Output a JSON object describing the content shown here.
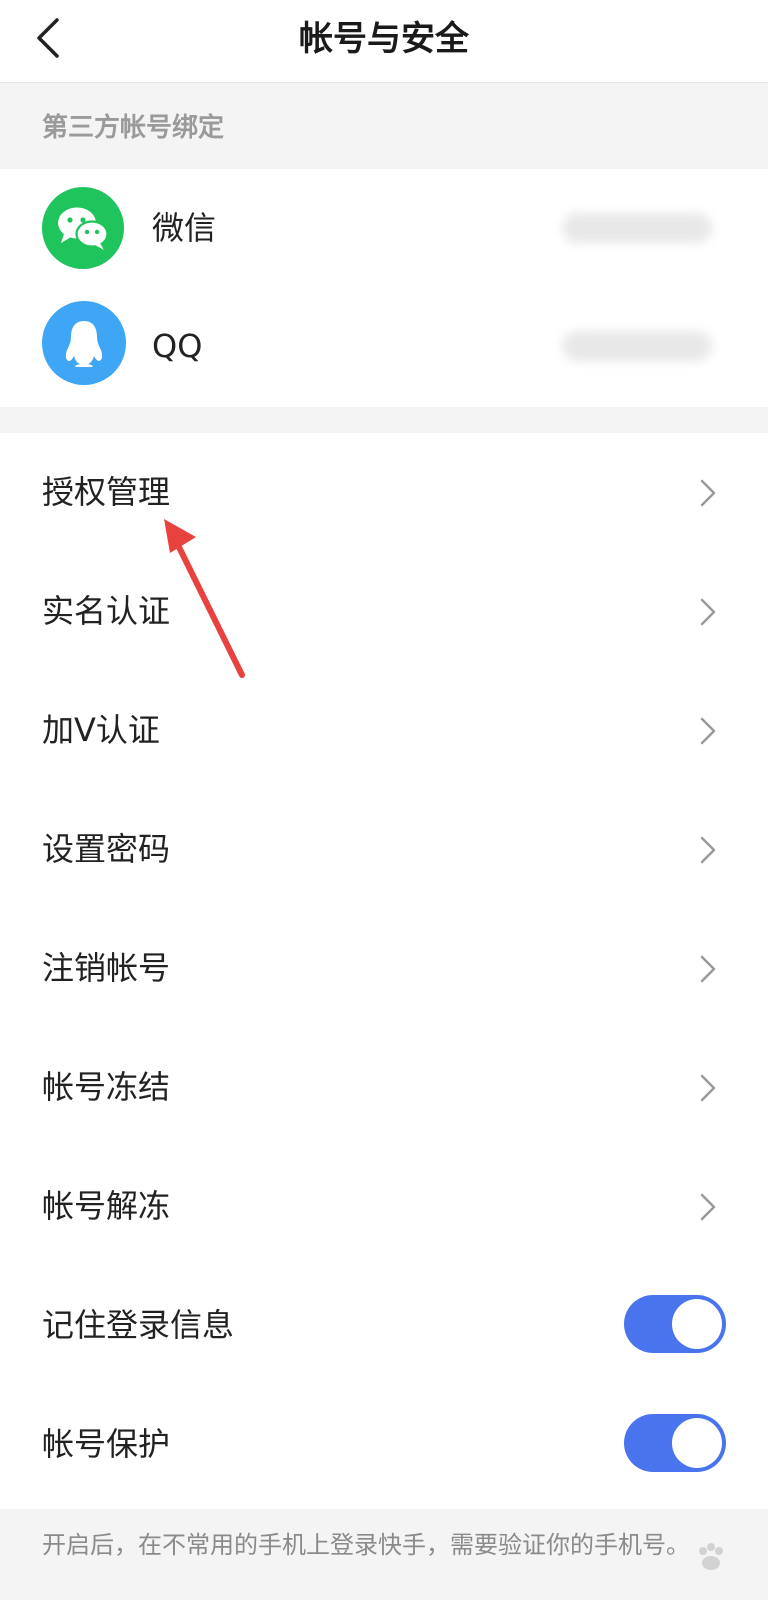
{
  "header": {
    "title": "帐号与安全",
    "back_icon": "chevron-left-icon"
  },
  "third_party": {
    "section_title": "第三方帐号绑定",
    "accounts": [
      {
        "label": "微信",
        "icon": "wechat-icon",
        "color": "#1fc45c"
      },
      {
        "label": "QQ",
        "icon": "qq-penguin-icon",
        "color": "#3fa5f5"
      }
    ]
  },
  "menu": {
    "items": [
      {
        "label": "授权管理"
      },
      {
        "label": "实名认证"
      },
      {
        "label": "加V认证"
      },
      {
        "label": "设置密码"
      },
      {
        "label": "注销帐号"
      },
      {
        "label": "帐号冻结"
      },
      {
        "label": "帐号解冻"
      }
    ],
    "toggles": [
      {
        "label": "记住登录信息",
        "on": true
      },
      {
        "label": "帐号保护",
        "on": true
      }
    ]
  },
  "footer": {
    "note": "开启后，在不常用的手机上登录快手，需要验证你的手机号。"
  },
  "colors": {
    "accent": "#4a74ee",
    "annotation": "#e8423f"
  }
}
